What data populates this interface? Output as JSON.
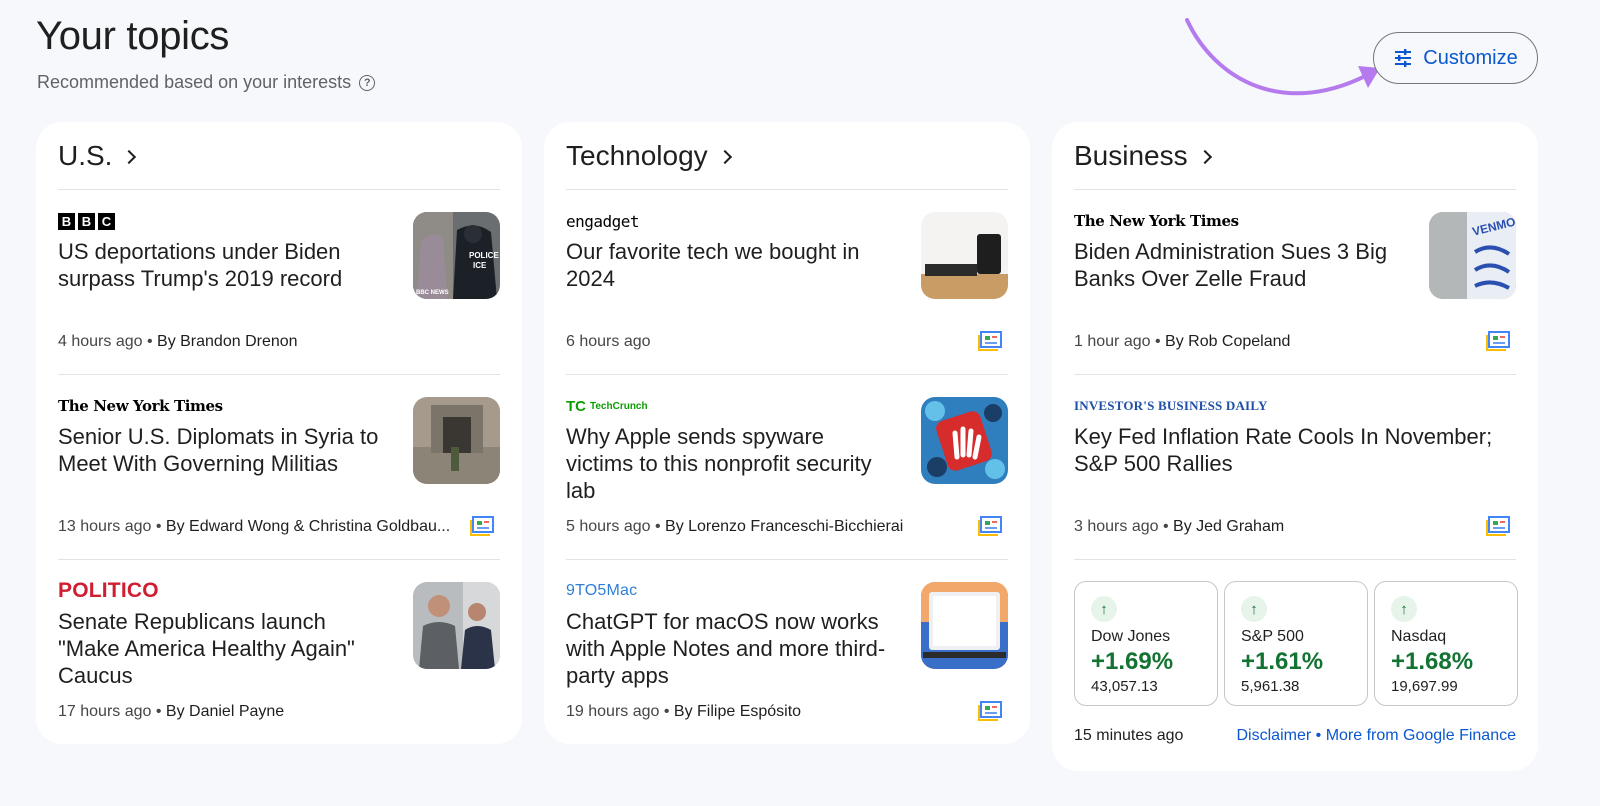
{
  "header": {
    "title": "Your topics",
    "subtitle": "Recommended based on your interests",
    "help_glyph": "?",
    "customize_label": "Customize"
  },
  "columns": [
    {
      "title": "U.S.",
      "stories": [
        {
          "source": "BBC",
          "headline": "US deportations under Biden surpass Trump's 2019 record",
          "time": "4 hours ago",
          "author": "By Brandon Drenon",
          "full_coverage": false
        },
        {
          "source": "The New York Times",
          "headline": "Senior U.S. Diplomats in Syria to Meet With Governing Militias",
          "time": "13 hours ago",
          "author": "By Edward Wong & Christina Goldbau...",
          "full_coverage": true
        },
        {
          "source": "POLITICO",
          "headline": "Senate Republicans launch \"Make America Healthy Again\" Caucus",
          "time": "17 hours ago",
          "author": "By Daniel Payne",
          "full_coverage": false
        }
      ]
    },
    {
      "title": "Technology",
      "stories": [
        {
          "source": "engadget",
          "headline": "Our favorite tech we bought in 2024",
          "time": "6 hours ago",
          "author": "",
          "full_coverage": true
        },
        {
          "source": "TechCrunch",
          "headline": "Why Apple sends spyware victims to this nonprofit security lab",
          "time": "5 hours ago",
          "author": "By Lorenzo Franceschi-Bicchierai",
          "full_coverage": true
        },
        {
          "source": "9TO5Mac",
          "headline": "ChatGPT for macOS now works with Apple Notes and more third-party apps",
          "time": "19 hours ago",
          "author": "By Filipe Espósito",
          "full_coverage": true
        }
      ]
    },
    {
      "title": "Business",
      "stories": [
        {
          "source": "The New York Times",
          "headline": "Biden Administration Sues 3 Big Banks Over Zelle Fraud",
          "time": "1 hour ago",
          "author": "By Rob Copeland",
          "full_coverage": true
        },
        {
          "source": "INVESTOR'S BUSINESS DAILY",
          "headline": "Key Fed Inflation Rate Cools In November; S&P 500 Rallies",
          "time": "3 hours ago",
          "author": "By Jed Graham",
          "full_coverage": true
        }
      ]
    }
  ],
  "finance": {
    "markets": [
      {
        "name": "Dow Jones",
        "change": "+1.69%",
        "value": "43,057.13",
        "arrow": "↑"
      },
      {
        "name": "S&P 500",
        "change": "+1.61%",
        "value": "5,961.38",
        "arrow": "↑"
      },
      {
        "name": "Nasdaq",
        "change": "+1.68%",
        "value": "19,697.99",
        "arrow": "↑"
      }
    ],
    "updated": "15 minutes ago",
    "disclaimer_label": "Disclaimer",
    "separator": "•",
    "more_label": "More from Google Finance"
  },
  "logos": {
    "bbc": [
      "B",
      "B",
      "C"
    ],
    "nyt": "The New York Times",
    "politico": "POLITICO",
    "engadget": "engadget",
    "techcrunch_mark": "TC",
    "techcrunch": "TechCrunch",
    "n9to5mac": "9TO5Mac",
    "ibd": "INVESTOR'S BUSINESS DAILY"
  },
  "thumb_text": {
    "police": "POLICE",
    "ice": "ICE",
    "bbc_news": "BBC NEWS",
    "venmo": "VENMO"
  },
  "colors": {
    "accent": "#0b57d0",
    "positive": "#137333",
    "annotation_arrow": "#b57bee"
  }
}
